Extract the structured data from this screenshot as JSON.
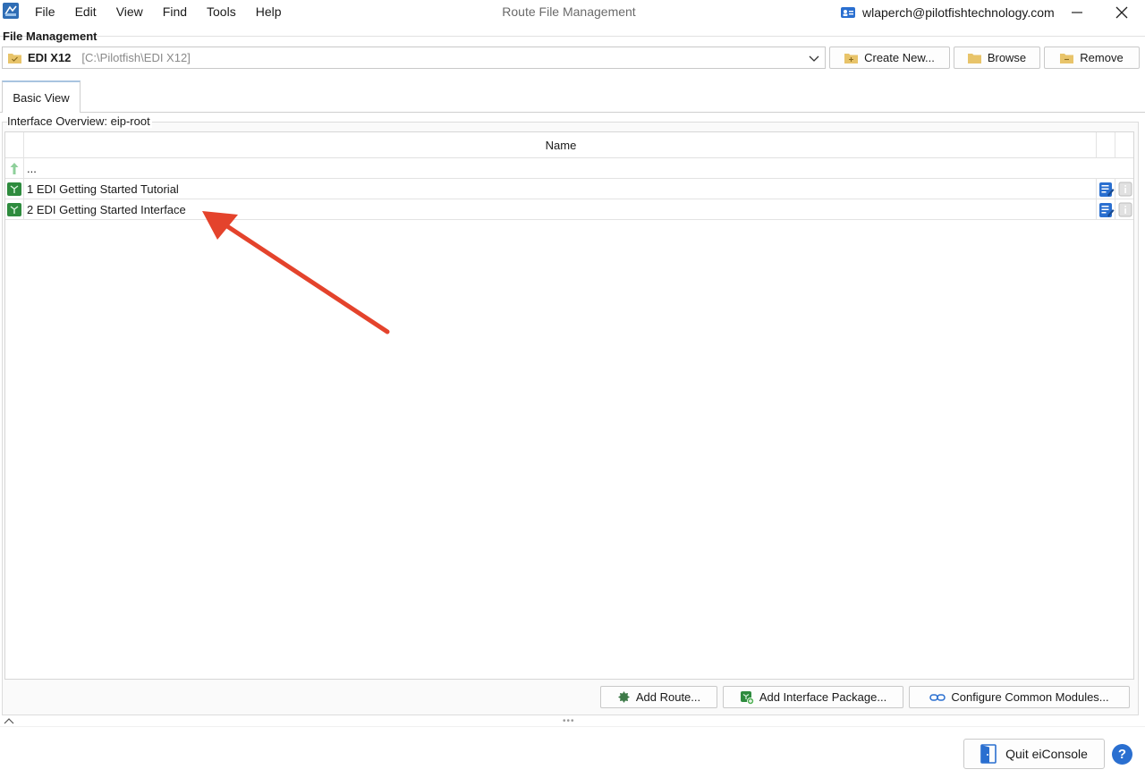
{
  "window": {
    "title": "Route File Management",
    "account_email": "wlaperch@pilotfishtechnology.com"
  },
  "menu": {
    "items": [
      "File",
      "Edit",
      "View",
      "Find",
      "Tools",
      "Help"
    ]
  },
  "file_management": {
    "label": "File Management",
    "selected_name": "EDI X12",
    "selected_path": "[C:\\Pilotfish\\EDI X12]",
    "create_label": "Create New...",
    "browse_label": "Browse",
    "remove_label": "Remove"
  },
  "tabs": [
    {
      "label": "Basic View",
      "active": true
    }
  ],
  "overview": {
    "title": "Interface Overview: eip-root",
    "column_name": "Name",
    "rows": [
      {
        "label": "...",
        "icon": "up-arrow-icon"
      },
      {
        "label": "1 EDI Getting Started Tutorial",
        "icon": "interface-cube-icon"
      },
      {
        "label": "2 EDI Getting Started Interface",
        "icon": "interface-cube-icon"
      }
    ]
  },
  "actions": {
    "add_route_label": "Add Route...",
    "add_package_label": "Add Interface Package...",
    "configure_label": "Configure Common Modules..."
  },
  "footer": {
    "quit_label": "Quit eiConsole",
    "help_label": "?"
  },
  "colors": {
    "accent": "#2a6fd0",
    "cube_green": "#2e8b3e",
    "folder_yellow": "#e8c46a",
    "annotation_red": "#e4432c"
  }
}
